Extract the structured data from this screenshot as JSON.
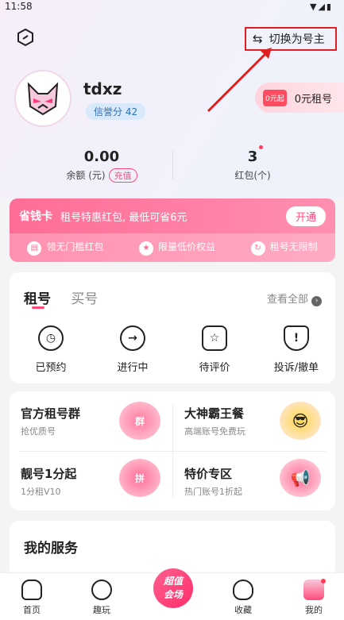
{
  "status": {
    "time": "11:58"
  },
  "header": {
    "switch_label": "切换为号主"
  },
  "profile": {
    "username": "tdxz",
    "credit": "信誉分 42",
    "zero_tag": "0元起",
    "zero_label": "0元租号"
  },
  "stats": {
    "balance_value": "0.00",
    "balance_label": "余额 (元)",
    "recharge": "充值",
    "redpack_value": "3",
    "redpack_label": "红包(个)"
  },
  "savecard": {
    "title": "省钱卡",
    "desc": "租号特惠红包, 最低可省6元",
    "open": "开通",
    "benefits": [
      "领无门槛红包",
      "限量低价权益",
      "租号无限制"
    ]
  },
  "orders": {
    "tab_rent": "租号",
    "tab_buy": "买号",
    "view_all": "查看全部",
    "items": [
      "已预约",
      "进行中",
      "待评价",
      "投诉/撤单"
    ]
  },
  "features": [
    {
      "title": "官方租号群",
      "sub": "抢优质号",
      "badge": "群"
    },
    {
      "title": "大神霸王餐",
      "sub": "高端账号免费玩"
    },
    {
      "title": "靓号1分起",
      "sub": "1分租V10",
      "badge": "拼"
    },
    {
      "title": "特价专区",
      "sub": "热门账号1折起"
    }
  ],
  "services": {
    "title": "我的服务"
  },
  "nav": {
    "home": "首页",
    "fun": "趣玩",
    "center_line1": "超值",
    "center_line2": "会场",
    "fav": "收藏",
    "mine": "我的"
  }
}
